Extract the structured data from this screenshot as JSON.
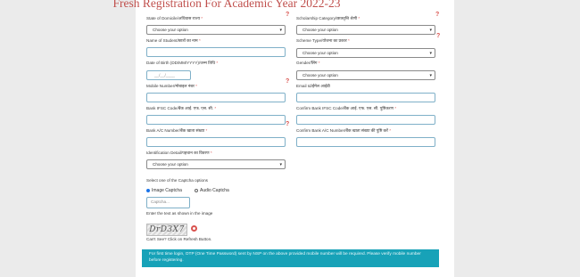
{
  "page": {
    "title": "Fresh Registration For Academic Year 2022-23"
  },
  "form": {
    "state_label": "State of Domicile/अधिवास राज्य",
    "state_value": "Choose your option",
    "scholarship_label": "Scholarship Category/छात्रवृत्ति श्रेणी",
    "scholarship_value": "Choose your option",
    "name_label": "Name of Student/छात्रों का नाम",
    "name_value": "",
    "scheme_label": "Scheme Type/योजना का प्रकार",
    "scheme_value": "Choose your option",
    "dob_label": "Date of Birth (DD/MM/YYYY)/जन्म तिथि",
    "dob_placeholder": "__/__/____",
    "gender_label": "Gender/लिंग",
    "gender_value": "Choose your option",
    "mobile_label": "Mobile Number/मोबाइल नंबर",
    "mobile_value": "",
    "email_label": "Email Id/ईमेल आईडी",
    "email_value": "",
    "ifsc_label": "Bank IFSC Code/बैंक आई. एफ. एस. सी.",
    "ifsc_value": "",
    "confirm_ifsc_label": "Confirm Bank IFSC Code/बैंक आई. एफ. एस. सी. पुष्टिकरण",
    "confirm_ifsc_value": "",
    "account_label": "Bank A/C Number/बैंक खाता संख्या",
    "account_value": "",
    "confirm_account_label": "Confirm Bank A/C Number/बैंक खाता संख्या की पुष्टि करें",
    "confirm_account_value": "",
    "identification_label": "Identification Detail/पहचान का विवरण",
    "identification_value": "Choose your option",
    "required_mark": "*",
    "help_mark": "?"
  },
  "captcha": {
    "options_label": "Select one of the Captcha options",
    "image_option": "Image Captcha",
    "audio_option": "Audio Captcha",
    "input_placeholder": "Captcha...",
    "instruction": "Enter the text as shown in the image",
    "image_text": "DrD3X7",
    "refresh_text": "Can't See? Click on Refresh Button."
  },
  "notice": {
    "text": "For first time login, OTP (One Time Password) sent by NSP on the above provided mobile number will be required. Please verify mobile number before registering."
  },
  "icons": {
    "dropdown": "chevron-down-icon",
    "refresh": "refresh-icon"
  },
  "colors": {
    "title": "#c0504d",
    "required": "#d9534f",
    "notice_bg": "#17a2b8",
    "input_border": "#7fb0c8"
  }
}
